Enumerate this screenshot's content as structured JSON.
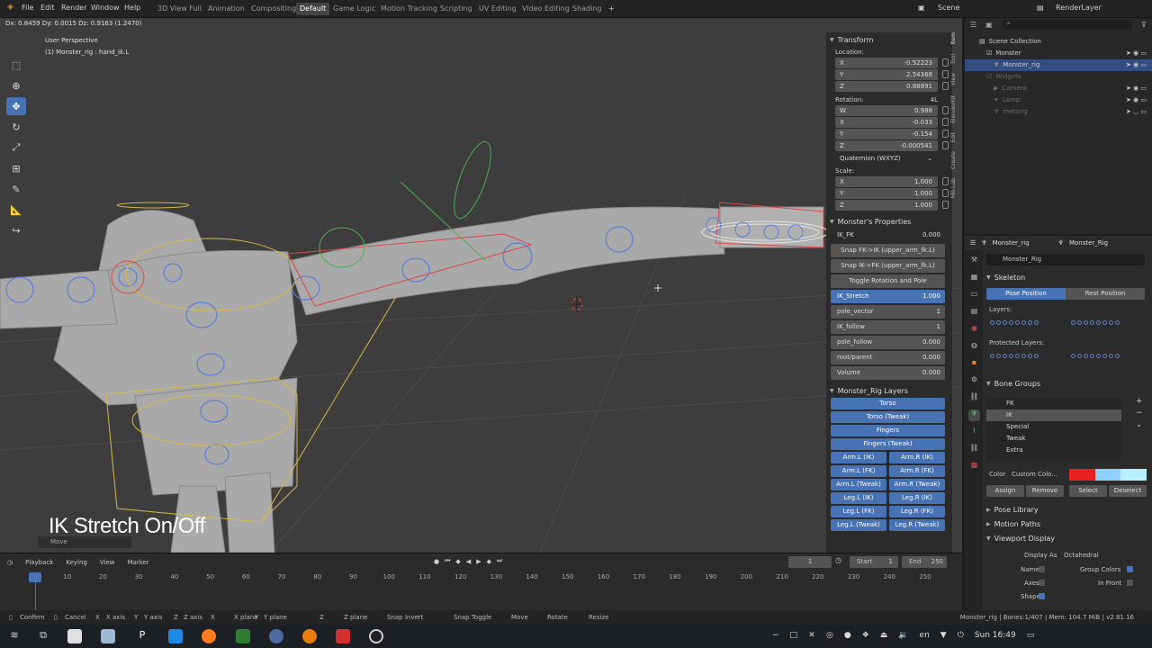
{
  "topbar": {
    "menus": [
      "File",
      "Edit",
      "Render",
      "Window",
      "Help"
    ],
    "workspaces": [
      "3D View Full",
      "Animation",
      "Compositing",
      "Default",
      "Game Logic",
      "Motion Tracking",
      "Scripting",
      "UV Editing",
      "Video Editing",
      "Shading"
    ],
    "active_workspace": "Default",
    "add_tab": "+",
    "scene": "Scene",
    "render_layer": "RenderLayer"
  },
  "viewport": {
    "delta_readout": "Dx: 0.8459 Dy: 0.0015 Dz: 0.9163 (1.2470)",
    "view_name": "User Perspective",
    "object_info": "(1) Monster_rig : hand_ik.L",
    "caption": "IK Stretch On/Off",
    "operator_label": "Move"
  },
  "transform": {
    "title": "Transform",
    "location_label": "Location:",
    "location": [
      {
        "k": "X",
        "v": "-0.52223"
      },
      {
        "k": "Y",
        "v": "2.54368"
      },
      {
        "k": "Z",
        "v": "0.88891"
      }
    ],
    "rotation_label": "Rotation:",
    "rotation_mode_tag": "4L",
    "rotation": [
      {
        "k": "W",
        "v": "0.988"
      },
      {
        "k": "X",
        "v": "-0.033"
      },
      {
        "k": "Y",
        "v": "-0.154"
      },
      {
        "k": "Z",
        "v": "-0.000541"
      }
    ],
    "rotation_mode": "Quaternion (WXYZ)",
    "scale_label": "Scale:",
    "scale": [
      {
        "k": "X",
        "v": "1.000"
      },
      {
        "k": "Y",
        "v": "1.000"
      },
      {
        "k": "Z",
        "v": "1.000"
      }
    ]
  },
  "monster_props": {
    "title": "Monster's Properties",
    "ik_fk": {
      "k": "IK_FK",
      "v": "0.000"
    },
    "snap1": "Snap FK->IK (upper_arm_fk.L)",
    "snap2": "Snap IK->FK (upper_arm_fk.L)",
    "toggle": "Toggle Rotation and Pole",
    "ik_stretch": {
      "k": "IK_Stretch",
      "v": "1.000"
    },
    "pole_vector": {
      "k": "pole_vector",
      "v": "1"
    },
    "ik_follow": {
      "k": "IK_follow",
      "v": "1"
    },
    "pole_follow": {
      "k": "pole_follow",
      "v": "0.000"
    },
    "root_parent": {
      "k": "root/parent",
      "v": "0.000"
    },
    "volume": {
      "k": "Volume",
      "v": "0.000"
    }
  },
  "rig_layers": {
    "title": "Monster_Rig Layers",
    "torso": "Torso",
    "torso_tweak": "Torso (Tweak)",
    "fingers": "Fingers",
    "fingers_tweak": "Fingers (Tweak)",
    "pairs": [
      [
        "Arm.L (IK)",
        "Arm.R (IK)"
      ],
      [
        "Arm.L (FK)",
        "Arm.R (FK)"
      ],
      [
        "Arm.L (Tweak)",
        "Arm.R (Tweak)"
      ],
      [
        "Leg.L (IK)",
        "Leg.R (IK)"
      ],
      [
        "Leg.L (FK)",
        "Leg.R (FK)"
      ],
      [
        "Leg.L (Tweak)",
        "Leg.R (Tweak)"
      ]
    ]
  },
  "side_tabs": [
    "Item",
    "Tool",
    "View",
    "BlenderKit",
    "Edit",
    "Create",
    "MB-Lab"
  ],
  "outliner": {
    "root": "Scene Collection",
    "items": [
      {
        "label": "Monster",
        "state": "normal",
        "indent": 1
      },
      {
        "label": "Monster_rig",
        "state": "selected",
        "indent": 2
      },
      {
        "label": "Widgets",
        "state": "dim",
        "indent": 1
      },
      {
        "label": "Camera",
        "state": "dim",
        "indent": 1
      },
      {
        "label": "Lamp",
        "state": "dim",
        "indent": 1
      },
      {
        "label": "metarig",
        "state": "dim",
        "indent": 1
      }
    ]
  },
  "properties": {
    "breadcrumb_obj": "Monster_rig",
    "breadcrumb_data": "Monster_Rig",
    "data_name": "Monster_Rig",
    "skeleton_title": "Skeleton",
    "pose_position": "Pose Position",
    "rest_position": "Rest Position",
    "layers_label": "Layers:",
    "protected_label": "Protected Layers:",
    "bone_groups_title": "Bone Groups",
    "bone_groups": [
      "FK",
      "IK",
      "Special",
      "Tweak",
      "Extra"
    ],
    "selected_group": "IK",
    "color_label": "Color",
    "color_set": "Custom Colo...",
    "color_swatches": [
      "#e81f1f",
      "#8fd1ff",
      "#b6f0ff"
    ],
    "assign": "Assign",
    "remove": "Remove",
    "select": "Select",
    "deselect": "Deselect",
    "pose_library": "Pose Library",
    "motion_paths": "Motion Paths",
    "viewport_display": "Viewport Display",
    "display_as_label": "Display As",
    "display_as": "Octahedral",
    "names": "Names",
    "group_colors": "Group Colors",
    "axes": "Axes",
    "in_front": "In Front",
    "shapes": "Shapes"
  },
  "timeline": {
    "menus": [
      "Playback",
      "Keying",
      "View",
      "Marker"
    ],
    "current_frame": "1",
    "start_label": "Start",
    "start": "1",
    "end_label": "End",
    "end": "250",
    "ticks": [
      "1",
      "10",
      "20",
      "30",
      "40",
      "50",
      "60",
      "70",
      "80",
      "90",
      "100",
      "110",
      "120",
      "130",
      "140",
      "150",
      "160",
      "170",
      "180",
      "190",
      "200",
      "210",
      "220",
      "230",
      "240",
      "250"
    ]
  },
  "statusbar": {
    "items": [
      "Confirm",
      "Cancel",
      "X axis",
      "Y axis",
      "Z axis",
      "X plane",
      "Y plane",
      "Z plane",
      "Snap Invert",
      "Snap Toggle",
      "Move",
      "Rotate",
      "Resize"
    ],
    "info": "Monster_rig | Bones:1/407 | Mem: 104.7 MiB | v2.81.16"
  },
  "taskbar": {
    "lang": "en",
    "clock": "Sun 16:49"
  }
}
